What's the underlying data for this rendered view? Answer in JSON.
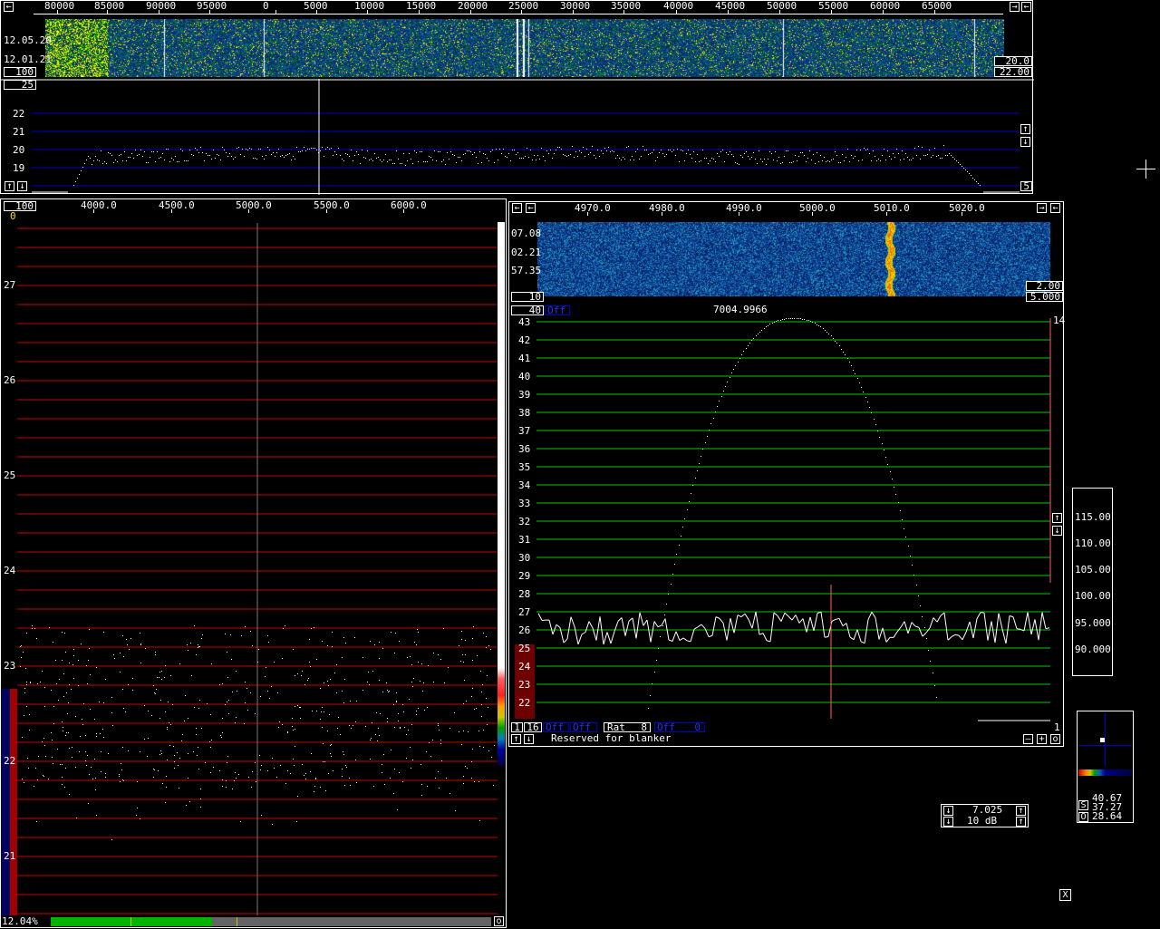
{
  "wide_graph": {
    "freq_ticks": [
      "80000",
      "85000",
      "90000",
      "95000",
      "0",
      "5000",
      "10000",
      "15000",
      "20000",
      "25000",
      "30000",
      "35000",
      "40000",
      "45000",
      "50000",
      "55000",
      "60000",
      "65000"
    ],
    "time_labels": [
      "12.05.20",
      "12.01.21"
    ],
    "avg_box": "100",
    "box_right_top": "20.0",
    "box_right_bottom": "22.00",
    "box_bottom_left": "25",
    "y_ticks": [
      "22",
      "21",
      "20",
      "19"
    ],
    "right_bottom_box": "5"
  },
  "hires_graph": {
    "avg_box": "100",
    "marker": "0",
    "freq_ticks": [
      "4000.0",
      "4500.0",
      "5000.0",
      "5500.0",
      "6000.0"
    ],
    "y_ticks": [
      "27",
      "26",
      "25",
      "24",
      "23",
      "22",
      "21"
    ],
    "status_text": "12.04%"
  },
  "baseband": {
    "freq_ticks": [
      "4970.0",
      "4980.0",
      "4990.0",
      "5000.0",
      "5010.0",
      "5020.0"
    ],
    "time_labels": [
      "07.08",
      "02.21",
      "57.35"
    ],
    "box_bottom_left": "10",
    "box_right_top": "2.00",
    "box_right_bottom": "5.000",
    "avg_box": "40",
    "off_label": "Off",
    "center_freq": "7004.9966",
    "right_number": "14",
    "y_ticks": [
      "43",
      "42",
      "41",
      "40",
      "39",
      "38",
      "37",
      "36",
      "35",
      "34",
      "33",
      "32",
      "31",
      "30",
      "29",
      "28",
      "27",
      "26",
      "25",
      "24",
      "23",
      "22"
    ],
    "ctrl_1": "1",
    "ctrl_16": "16",
    "ctrl_off1": "Off",
    "ctrl_off2": "Off",
    "ctrl_rat_label": "Rat",
    "ctrl_rat_value": "8",
    "ctrl_off3": "Off",
    "ctrl_last": "0",
    "bottom_right_number": "1",
    "blanker_text": "Reserved for blanker"
  },
  "s_meter": {
    "values": [
      "115.00",
      "110.00",
      "105.00",
      "100.00",
      "95.000",
      "90.000"
    ]
  },
  "freq_control": {
    "freq": "7.025",
    "gain": "10 dB"
  },
  "coherent": {
    "s_label": "S",
    "o_label": "O",
    "values": [
      "40.67",
      "37.27",
      "28.64"
    ]
  },
  "close_label": "X",
  "colors": {
    "grid_blue": "#0000c8",
    "grid_red": "#c80000",
    "grid_green": "#00c800",
    "accent_blue": "#2a2aff"
  }
}
